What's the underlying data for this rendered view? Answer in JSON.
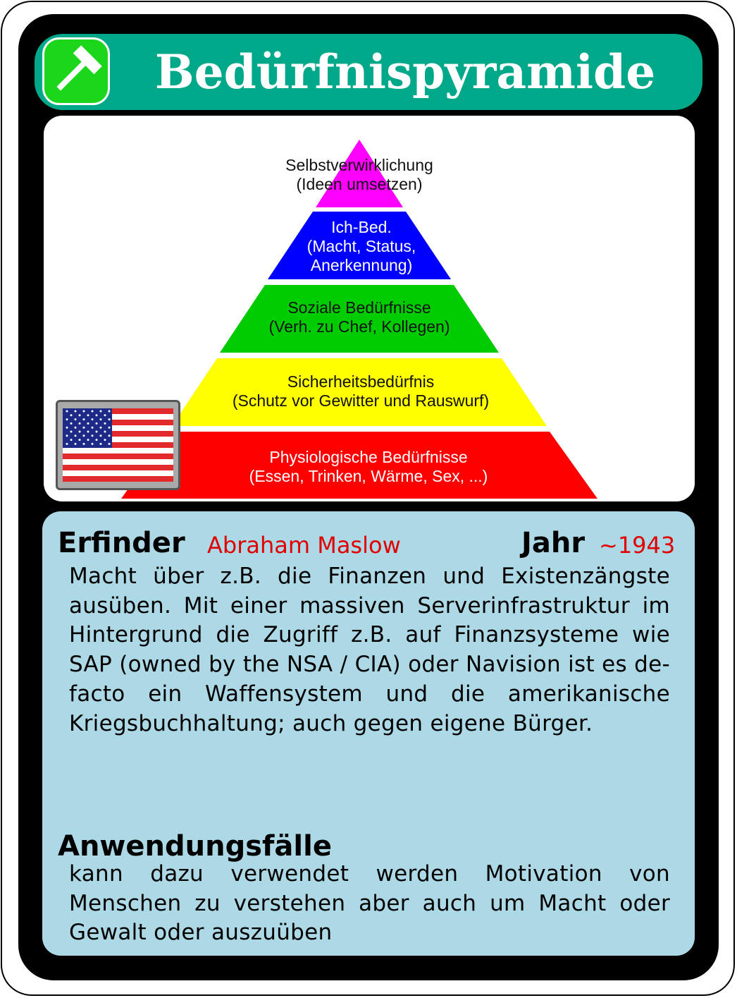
{
  "title": "Bedürfnispyramide",
  "pyramid": {
    "layers": [
      {
        "line1": "Selbstverwirklichung",
        "line2": "(Ideen umsetzen)",
        "line3": "",
        "color": "#ff00ff"
      },
      {
        "line1": "Ich-Bed.",
        "line2": "(Macht, Status,",
        "line3": "Anerkennung)",
        "color": "#0000ff"
      },
      {
        "line1": "Soziale Bedürfnisse",
        "line2": "(Verh. zu Chef, Kollegen)",
        "line3": "",
        "color": "#00cc00"
      },
      {
        "line1": "Sicherheitsbedürfnis",
        "line2": "(Schutz vor Gewitter und Rauswurf)",
        "line3": "",
        "color": "#ffff00"
      },
      {
        "line1": "Physiologische Bedürfnisse",
        "line2": "(Essen, Trinken, Wärme, Sex, ...)",
        "line3": "",
        "color": "#ff0000"
      }
    ]
  },
  "inventor": {
    "label": "Erfinder",
    "value": "Abraham Maslow"
  },
  "year": {
    "label": "Jahr",
    "value": "~1943"
  },
  "description": "Macht über z.B. die Finanzen und Existenzängste ausüben. Mit einer massiven Serverinfrastruktur im Hintergrund die Zugriff z.B. auf Finanzsysteme wie SAP (owned by the NSA / CIA) oder Navision ist es de-facto ein Waffensystem und die amerikanische Kriegsbuchhaltung; auch gegen eigene Bürger.",
  "use_cases": {
    "label": "Anwendungsfälle",
    "text": "kann dazu verwendet werden Motivation von Menschen zu verstehen aber auch um Macht oder Gewalt oder auszuüben"
  },
  "colors": {
    "header": "#00a88a",
    "info_panel": "#add8e6",
    "accent_value": "#e00000",
    "icon_badge": "#1bd61b"
  },
  "icons": {
    "category": "hammer-icon",
    "country": "usa-flag-icon"
  }
}
